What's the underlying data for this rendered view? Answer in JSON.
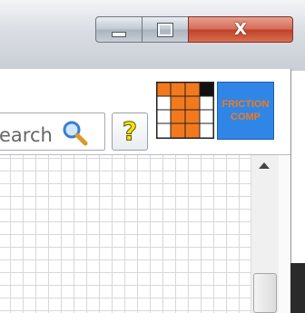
{
  "window": {
    "caption_buttons": {
      "minimize_icon": "minimize-icon",
      "maximize_icon": "maximize-icon",
      "close_label": "X"
    }
  },
  "toolbar": {
    "search": {
      "value": "earch"
    },
    "help_label": "?",
    "friction_button": {
      "line1": "FRICTION",
      "line2": "COMP"
    }
  },
  "colors": {
    "close_red": "#c0402b",
    "friction_blue": "#2f86e6",
    "friction_text": "#f27a1d",
    "grid_orange": "#f27a1d"
  }
}
